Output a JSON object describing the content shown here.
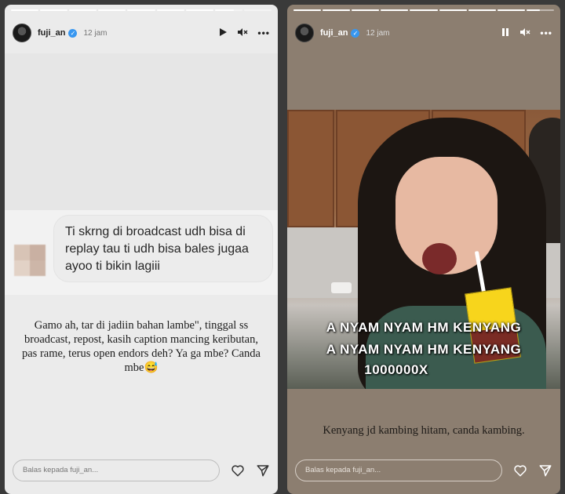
{
  "stories": [
    {
      "username": "fuji_an",
      "time": "12 jam",
      "progress": [
        1,
        1,
        1,
        1,
        1,
        1,
        1,
        0.7,
        0
      ],
      "dm_message": "Ti skrng di broadcast udh bisa di replay tau ti udh bisa bales jugaa ayoo ti bikin lagiii",
      "caption": "Gamo ah, tar di jadiin bahan lambe\", tinggal ss broadcast, repost, kasih caption mancing keributan, pas rame, terus open endors deh? Ya ga mbe? Canda mbe😅",
      "reply_placeholder": "Balas kepada fuji_an...",
      "controls": {
        "play": "▶",
        "mute": "🔇",
        "more": "•••"
      }
    },
    {
      "username": "fuji_an",
      "time": "12 jam",
      "progress": [
        1,
        1,
        1,
        1,
        1,
        1,
        1,
        1,
        0.5
      ],
      "overlay_lines": [
        "A NYAM NYAM HM KENYANG",
        "A NYAM NYAM HM KENYANG",
        "1000000X"
      ],
      "caption": "Kenyang jd kambing hitam, canda kambing.",
      "reply_placeholder": "Balas kepada fuji_an...",
      "controls": {
        "pause": "❚❚",
        "mute": "🔇",
        "more": "•••"
      }
    }
  ],
  "verified_badge": "✓",
  "colors": {
    "verified": "#3897f0",
    "story1_bg": "#ebebeb",
    "story2_bg": "#8c7e70"
  }
}
